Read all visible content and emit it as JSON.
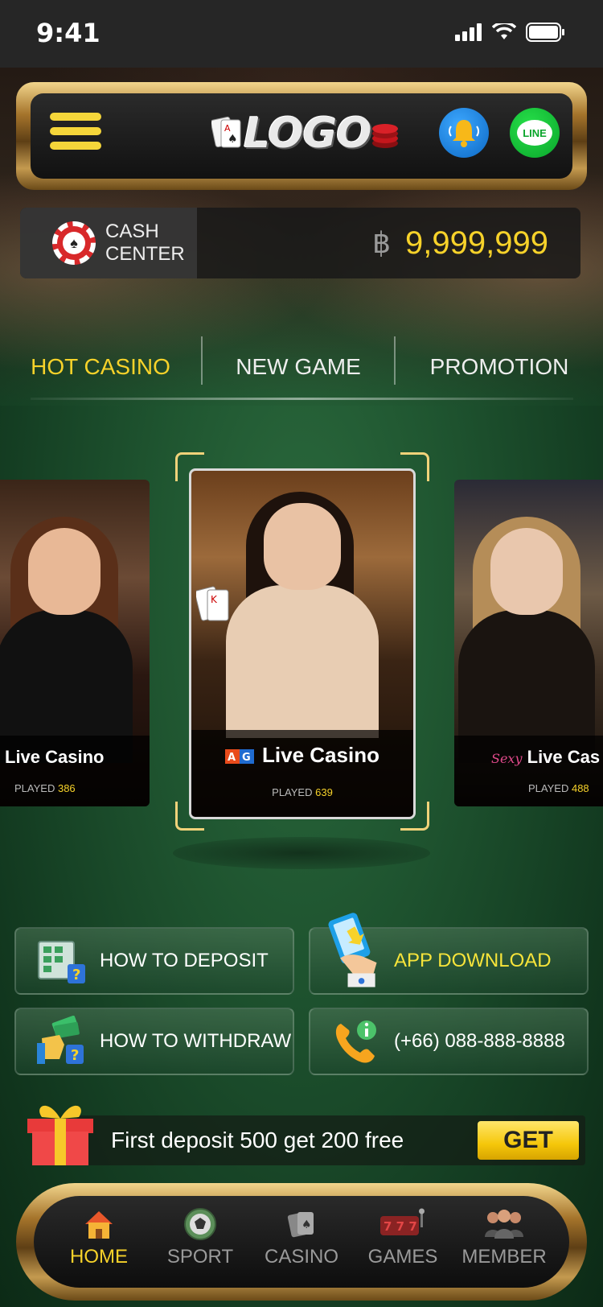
{
  "status_bar": {
    "time": "9:41"
  },
  "header": {
    "logo_text": "LOGO",
    "menu_icon": "hamburger-menu-icon",
    "bell_icon": "bell-icon",
    "line_label": "LINE"
  },
  "cash": {
    "label_line1": "CASH",
    "label_line2": "CENTER",
    "currency": "฿",
    "balance": "9,999,999"
  },
  "tabs": [
    {
      "label": "HOT CASINO",
      "active": true
    },
    {
      "label": "NEW GAME",
      "active": false
    },
    {
      "label": "PROMOTION",
      "active": false
    }
  ],
  "games": {
    "left": {
      "title": "Live Casino",
      "played_label": "PLAYED",
      "played_count": "386"
    },
    "center": {
      "title": "Live Casino",
      "played_label": "PLAYED",
      "played_count": "639",
      "brand": "AG"
    },
    "right": {
      "title": "Live Cas",
      "played_label": "PLAYED",
      "played_count": "488",
      "brand": "Sexy"
    }
  },
  "actions": {
    "deposit": "HOW TO DEPOSIT",
    "app_download": "APP DOWNLOAD",
    "withdraw": "HOW TO WITHDRAW",
    "phone": "(+66) 088-888-8888"
  },
  "promo": {
    "text": "First deposit 500 get 200 free",
    "button": "GET"
  },
  "bottom_nav": [
    {
      "label": "HOME",
      "icon": "home-icon",
      "active": true
    },
    {
      "label": "SPORT",
      "icon": "soccer-ball-icon",
      "active": false
    },
    {
      "label": "CASINO",
      "icon": "cards-icon",
      "active": false
    },
    {
      "label": "GAMES",
      "icon": "slot-machine-icon",
      "active": false
    },
    {
      "label": "MEMBER",
      "icon": "member-icon",
      "active": false
    }
  ],
  "colors": {
    "accent": "#f7d22a",
    "background": "#1f5530",
    "gold_frame": "#c49a4f"
  }
}
